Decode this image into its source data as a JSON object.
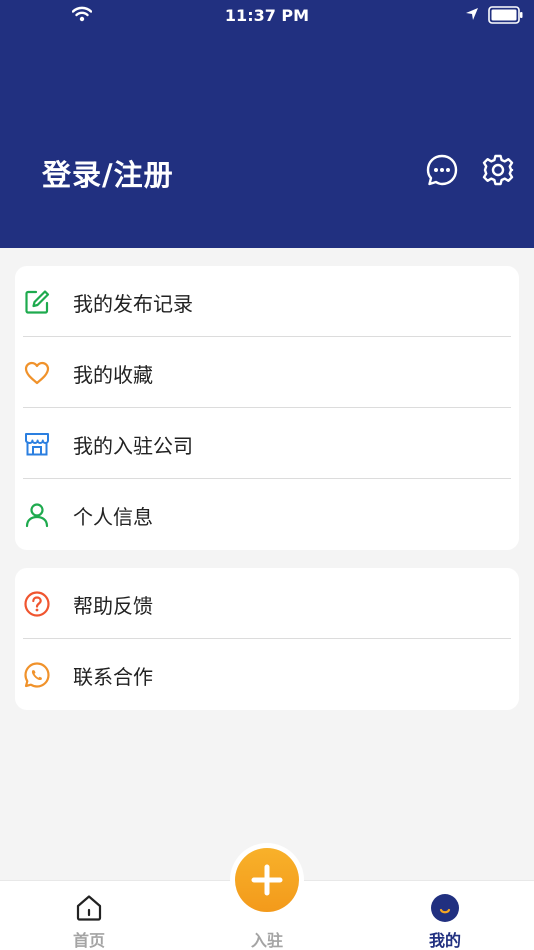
{
  "status_bar": {
    "time": "11:37 PM",
    "icons": [
      "wifi-icon",
      "location-arrow-icon",
      "battery-icon"
    ]
  },
  "header": {
    "title": "登录/注册",
    "bg_color": "#213080",
    "actions": [
      "message-icon",
      "gear-icon"
    ]
  },
  "menu_groups": [
    {
      "items": [
        {
          "label": "我的发布记录",
          "icon": "edit-icon",
          "icon_color": "#1eaa4e"
        },
        {
          "label": "我的收藏",
          "icon": "heart-icon",
          "icon_color": "#f0922b"
        },
        {
          "label": "我的入驻公司",
          "icon": "store-icon",
          "icon_color": "#2b7fe0"
        },
        {
          "label": "个人信息",
          "icon": "user-icon",
          "icon_color": "#1eaa4e"
        }
      ]
    },
    {
      "items": [
        {
          "label": "帮助反馈",
          "icon": "help-icon",
          "icon_color": "#f0552f"
        },
        {
          "label": "联系合作",
          "icon": "phone-icon",
          "icon_color": "#f0922b"
        }
      ]
    }
  ],
  "tabbar": {
    "items": [
      {
        "label": "首页",
        "icon": "home-icon",
        "active": false
      },
      {
        "label": "入驻",
        "icon": "plus-icon",
        "active": false
      },
      {
        "label": "我的",
        "icon": "smile-icon",
        "active": true
      }
    ],
    "active_color": "#213080",
    "inactive_color": "#a4a4a4",
    "accent_color": "#f5a623"
  }
}
